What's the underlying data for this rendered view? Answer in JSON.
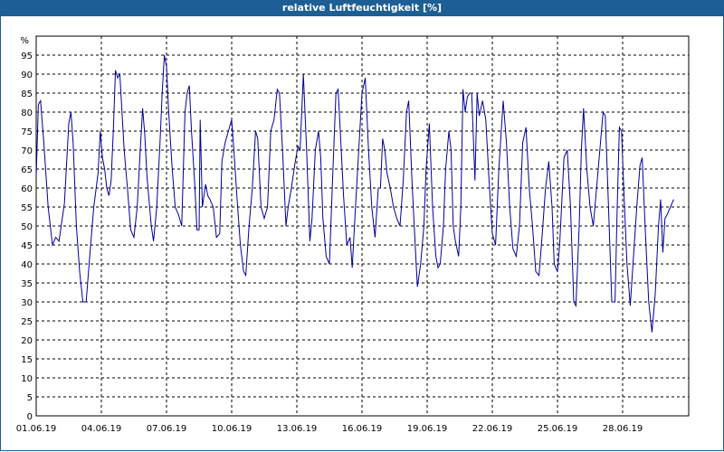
{
  "window": {
    "title": "relative Luftfeuchtigkeit [%]",
    "title_bg": "#1d5f94",
    "title_color": "#ffffff"
  },
  "chart_data": {
    "type": "line",
    "title": "relative Luftfeuchtigkeit [%]",
    "ylabel": "%",
    "xlabel": "",
    "ylim": [
      0,
      100
    ],
    "yticks": [
      0,
      5,
      10,
      15,
      20,
      25,
      30,
      35,
      40,
      45,
      50,
      55,
      60,
      65,
      70,
      75,
      80,
      85,
      90,
      95
    ],
    "x_range_days": [
      "01.06.19",
      "30.06.19"
    ],
    "xticks": [
      "01.06.19",
      "04.06.19",
      "07.06.19",
      "10.06.19",
      "13.06.19",
      "16.06.19",
      "19.06.19",
      "22.06.19",
      "25.06.19",
      "28.06.19"
    ],
    "grid": true,
    "line_color": "#000099",
    "series": [
      {
        "values": [
          [
            0.0,
            63
          ],
          [
            0.1,
            82
          ],
          [
            0.2,
            83
          ],
          [
            0.35,
            72
          ],
          [
            0.55,
            55
          ],
          [
            0.75,
            45
          ],
          [
            0.9,
            47
          ],
          [
            1.05,
            46
          ],
          [
            1.3,
            56
          ],
          [
            1.5,
            77
          ],
          [
            1.6,
            80
          ],
          [
            1.7,
            72
          ],
          [
            1.85,
            50
          ],
          [
            2.0,
            38
          ],
          [
            2.15,
            30
          ],
          [
            2.3,
            30
          ],
          [
            2.45,
            41
          ],
          [
            2.65,
            55
          ],
          [
            2.85,
            64
          ],
          [
            2.95,
            75
          ],
          [
            3.05,
            68
          ],
          [
            3.15,
            65
          ],
          [
            3.25,
            60
          ],
          [
            3.35,
            58
          ],
          [
            3.45,
            62
          ],
          [
            3.55,
            75
          ],
          [
            3.65,
            91
          ],
          [
            3.75,
            89
          ],
          [
            3.85,
            90
          ],
          [
            3.95,
            80
          ],
          [
            4.05,
            70
          ],
          [
            4.2,
            60
          ],
          [
            4.35,
            49
          ],
          [
            4.5,
            47
          ],
          [
            4.65,
            55
          ],
          [
            4.8,
            71
          ],
          [
            4.9,
            81
          ],
          [
            5.0,
            74
          ],
          [
            5.1,
            63
          ],
          [
            5.3,
            50
          ],
          [
            5.4,
            46
          ],
          [
            5.55,
            55
          ],
          [
            5.7,
            72
          ],
          [
            5.8,
            85
          ],
          [
            5.9,
            95
          ],
          [
            6.0,
            92
          ],
          [
            6.1,
            80
          ],
          [
            6.25,
            66
          ],
          [
            6.4,
            55
          ],
          [
            6.55,
            53
          ],
          [
            6.7,
            50
          ],
          [
            6.85,
            80
          ],
          [
            6.95,
            85
          ],
          [
            7.05,
            87
          ],
          [
            7.15,
            75
          ],
          [
            7.3,
            61
          ],
          [
            7.4,
            49
          ],
          [
            7.5,
            49
          ],
          [
            7.55,
            78
          ],
          [
            7.65,
            55
          ],
          [
            7.8,
            61
          ],
          [
            7.9,
            58
          ],
          [
            8.0,
            57
          ],
          [
            8.15,
            55
          ],
          [
            8.3,
            47
          ],
          [
            8.45,
            48
          ],
          [
            8.55,
            67
          ],
          [
            8.7,
            72
          ],
          [
            8.85,
            75
          ],
          [
            9.0,
            78
          ],
          [
            9.1,
            70
          ],
          [
            9.25,
            57
          ],
          [
            9.4,
            45
          ],
          [
            9.55,
            38
          ],
          [
            9.65,
            37
          ],
          [
            9.8,
            50
          ],
          [
            9.95,
            60
          ],
          [
            10.1,
            75
          ],
          [
            10.2,
            73
          ],
          [
            10.35,
            55
          ],
          [
            10.5,
            52
          ],
          [
            10.65,
            55
          ],
          [
            10.8,
            75
          ],
          [
            10.95,
            78
          ],
          [
            11.1,
            86
          ],
          [
            11.2,
            85
          ],
          [
            11.35,
            69
          ],
          [
            11.5,
            50
          ],
          [
            11.6,
            55
          ],
          [
            11.75,
            60
          ],
          [
            11.9,
            66
          ],
          [
            12.05,
            71
          ],
          [
            12.15,
            70
          ],
          [
            12.3,
            90
          ],
          [
            12.45,
            70
          ],
          [
            12.6,
            46
          ],
          [
            12.7,
            52
          ],
          [
            12.85,
            70
          ],
          [
            13.0,
            75
          ],
          [
            13.1,
            68
          ],
          [
            13.2,
            52
          ],
          [
            13.35,
            42
          ],
          [
            13.5,
            40
          ],
          [
            13.65,
            63
          ],
          [
            13.8,
            85
          ],
          [
            13.9,
            86
          ],
          [
            14.0,
            75
          ],
          [
            14.15,
            58
          ],
          [
            14.3,
            45
          ],
          [
            14.45,
            47
          ],
          [
            14.55,
            39
          ],
          [
            14.7,
            55
          ],
          [
            14.85,
            70
          ],
          [
            15.0,
            85
          ],
          [
            15.15,
            89
          ],
          [
            15.3,
            70
          ],
          [
            15.45,
            55
          ],
          [
            15.6,
            47
          ],
          [
            15.75,
            60
          ],
          [
            15.85,
            60
          ],
          [
            15.95,
            73
          ],
          [
            16.05,
            70
          ],
          [
            16.15,
            64
          ],
          [
            16.3,
            60
          ],
          [
            16.45,
            55
          ],
          [
            16.6,
            52
          ],
          [
            16.75,
            50
          ],
          [
            16.9,
            62
          ],
          [
            17.05,
            80
          ],
          [
            17.15,
            83
          ],
          [
            17.3,
            62
          ],
          [
            17.45,
            45
          ],
          [
            17.55,
            34
          ],
          [
            17.7,
            40
          ],
          [
            17.85,
            50
          ],
          [
            17.95,
            65
          ],
          [
            18.1,
            77
          ],
          [
            18.25,
            55
          ],
          [
            18.4,
            42
          ],
          [
            18.5,
            39
          ],
          [
            18.6,
            40
          ],
          [
            18.75,
            50
          ],
          [
            18.85,
            65
          ],
          [
            19.0,
            75
          ],
          [
            19.1,
            70
          ],
          [
            19.2,
            50
          ],
          [
            19.3,
            46
          ],
          [
            19.45,
            42
          ],
          [
            19.55,
            55
          ],
          [
            19.65,
            86
          ],
          [
            19.75,
            80
          ],
          [
            19.85,
            84
          ],
          [
            19.95,
            85
          ],
          [
            20.05,
            85
          ],
          [
            20.2,
            62
          ],
          [
            20.3,
            85
          ],
          [
            20.4,
            79
          ],
          [
            20.55,
            83
          ],
          [
            20.7,
            78
          ],
          [
            20.85,
            62
          ],
          [
            21.0,
            48
          ],
          [
            21.15,
            45
          ],
          [
            21.3,
            65
          ],
          [
            21.5,
            83
          ],
          [
            21.65,
            72
          ],
          [
            21.8,
            55
          ],
          [
            21.95,
            44
          ],
          [
            22.1,
            42
          ],
          [
            22.25,
            50
          ],
          [
            22.4,
            72
          ],
          [
            22.55,
            76
          ],
          [
            22.7,
            60
          ],
          [
            22.85,
            50
          ],
          [
            23.0,
            38
          ],
          [
            23.15,
            37
          ],
          [
            23.3,
            48
          ],
          [
            23.45,
            60
          ],
          [
            23.6,
            67
          ],
          [
            23.75,
            55
          ],
          [
            23.85,
            40
          ],
          [
            24.0,
            38
          ],
          [
            24.1,
            45
          ],
          [
            24.3,
            68
          ],
          [
            24.45,
            70
          ],
          [
            24.6,
            55
          ],
          [
            24.75,
            30
          ],
          [
            24.85,
            29
          ],
          [
            25.0,
            50
          ],
          [
            25.1,
            70
          ],
          [
            25.2,
            81
          ],
          [
            25.35,
            65
          ],
          [
            25.5,
            55
          ],
          [
            25.65,
            50
          ],
          [
            25.8,
            60
          ],
          [
            25.95,
            70
          ],
          [
            26.1,
            80
          ],
          [
            26.2,
            79
          ],
          [
            26.35,
            55
          ],
          [
            26.5,
            30
          ],
          [
            26.65,
            30
          ],
          [
            26.75,
            55
          ],
          [
            26.85,
            76
          ],
          [
            26.95,
            75
          ],
          [
            27.05,
            60
          ],
          [
            27.2,
            40
          ],
          [
            27.35,
            29
          ],
          [
            27.5,
            42
          ],
          [
            27.65,
            55
          ],
          [
            27.8,
            66
          ],
          [
            27.9,
            68
          ],
          [
            28.05,
            48
          ],
          [
            28.2,
            30
          ],
          [
            28.35,
            22
          ],
          [
            28.5,
            32
          ],
          [
            28.65,
            50
          ],
          [
            28.75,
            57
          ],
          [
            28.85,
            43
          ],
          [
            28.95,
            52
          ],
          [
            29.05,
            53
          ],
          [
            29.2,
            55
          ],
          [
            29.35,
            57
          ]
        ]
      }
    ]
  }
}
